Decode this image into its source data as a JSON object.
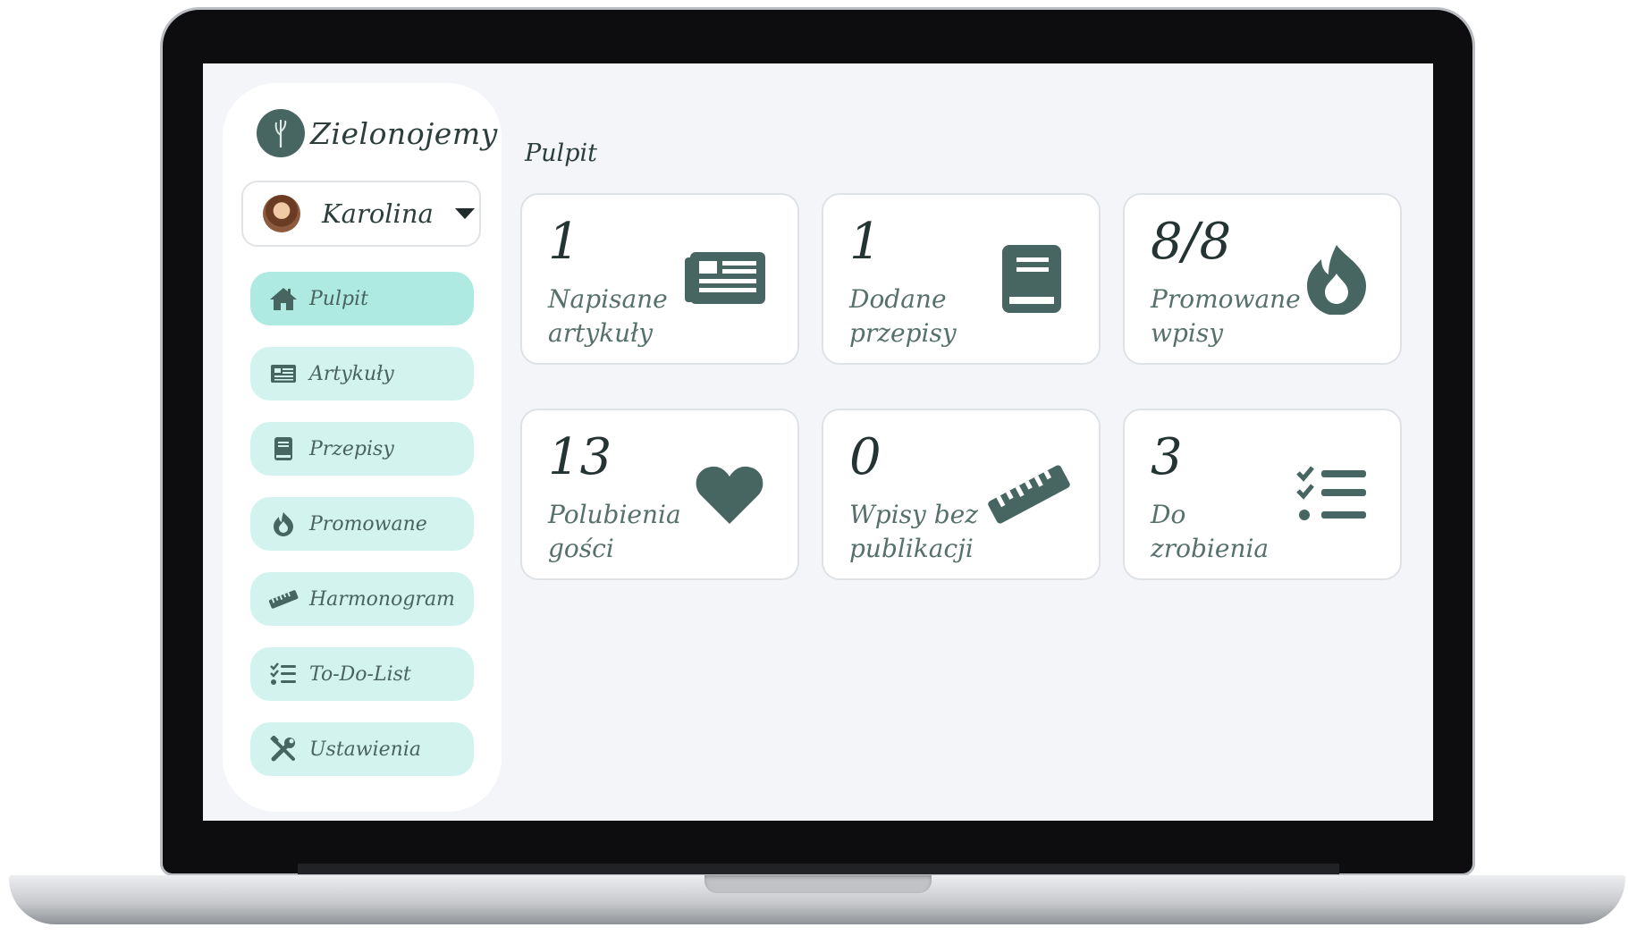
{
  "brand": {
    "name": "Zielonojemy",
    "icon": "sprout-icon"
  },
  "user": {
    "name": "Karolina"
  },
  "nav": [
    {
      "label": "Pulpit",
      "icon": "home-icon",
      "active": true
    },
    {
      "label": "Artykuły",
      "icon": "newspaper-icon"
    },
    {
      "label": "Przepisy",
      "icon": "book-icon"
    },
    {
      "label": "Promowane",
      "icon": "fire-icon"
    },
    {
      "label": "Harmonogram",
      "icon": "ruler-icon"
    },
    {
      "label": "To-Do-List",
      "icon": "tasks-icon"
    },
    {
      "label": "Ustawienia",
      "icon": "tools-icon"
    }
  ],
  "page": {
    "title": "Pulpit"
  },
  "cards": [
    {
      "value": "1",
      "label": "Napisane artykuły",
      "icon": "newspaper-icon"
    },
    {
      "value": "1",
      "label": "Dodane przepisy",
      "icon": "book-icon"
    },
    {
      "value": "8/8",
      "label": "Promowane wpisy",
      "icon": "fire-icon"
    },
    {
      "value": "13",
      "label": "Polubienia gości",
      "icon": "heart-icon"
    },
    {
      "value": "0",
      "label": "Wpisy bez publikacji",
      "icon": "ruler-icon"
    },
    {
      "value": "3",
      "label": "Do zrobienia",
      "icon": "tasks-icon"
    }
  ],
  "colors": {
    "accent": "#476662",
    "nav_bg": "#d2f3ee",
    "nav_active_bg": "#aeeae2",
    "screen_bg": "#f4f5f9"
  }
}
